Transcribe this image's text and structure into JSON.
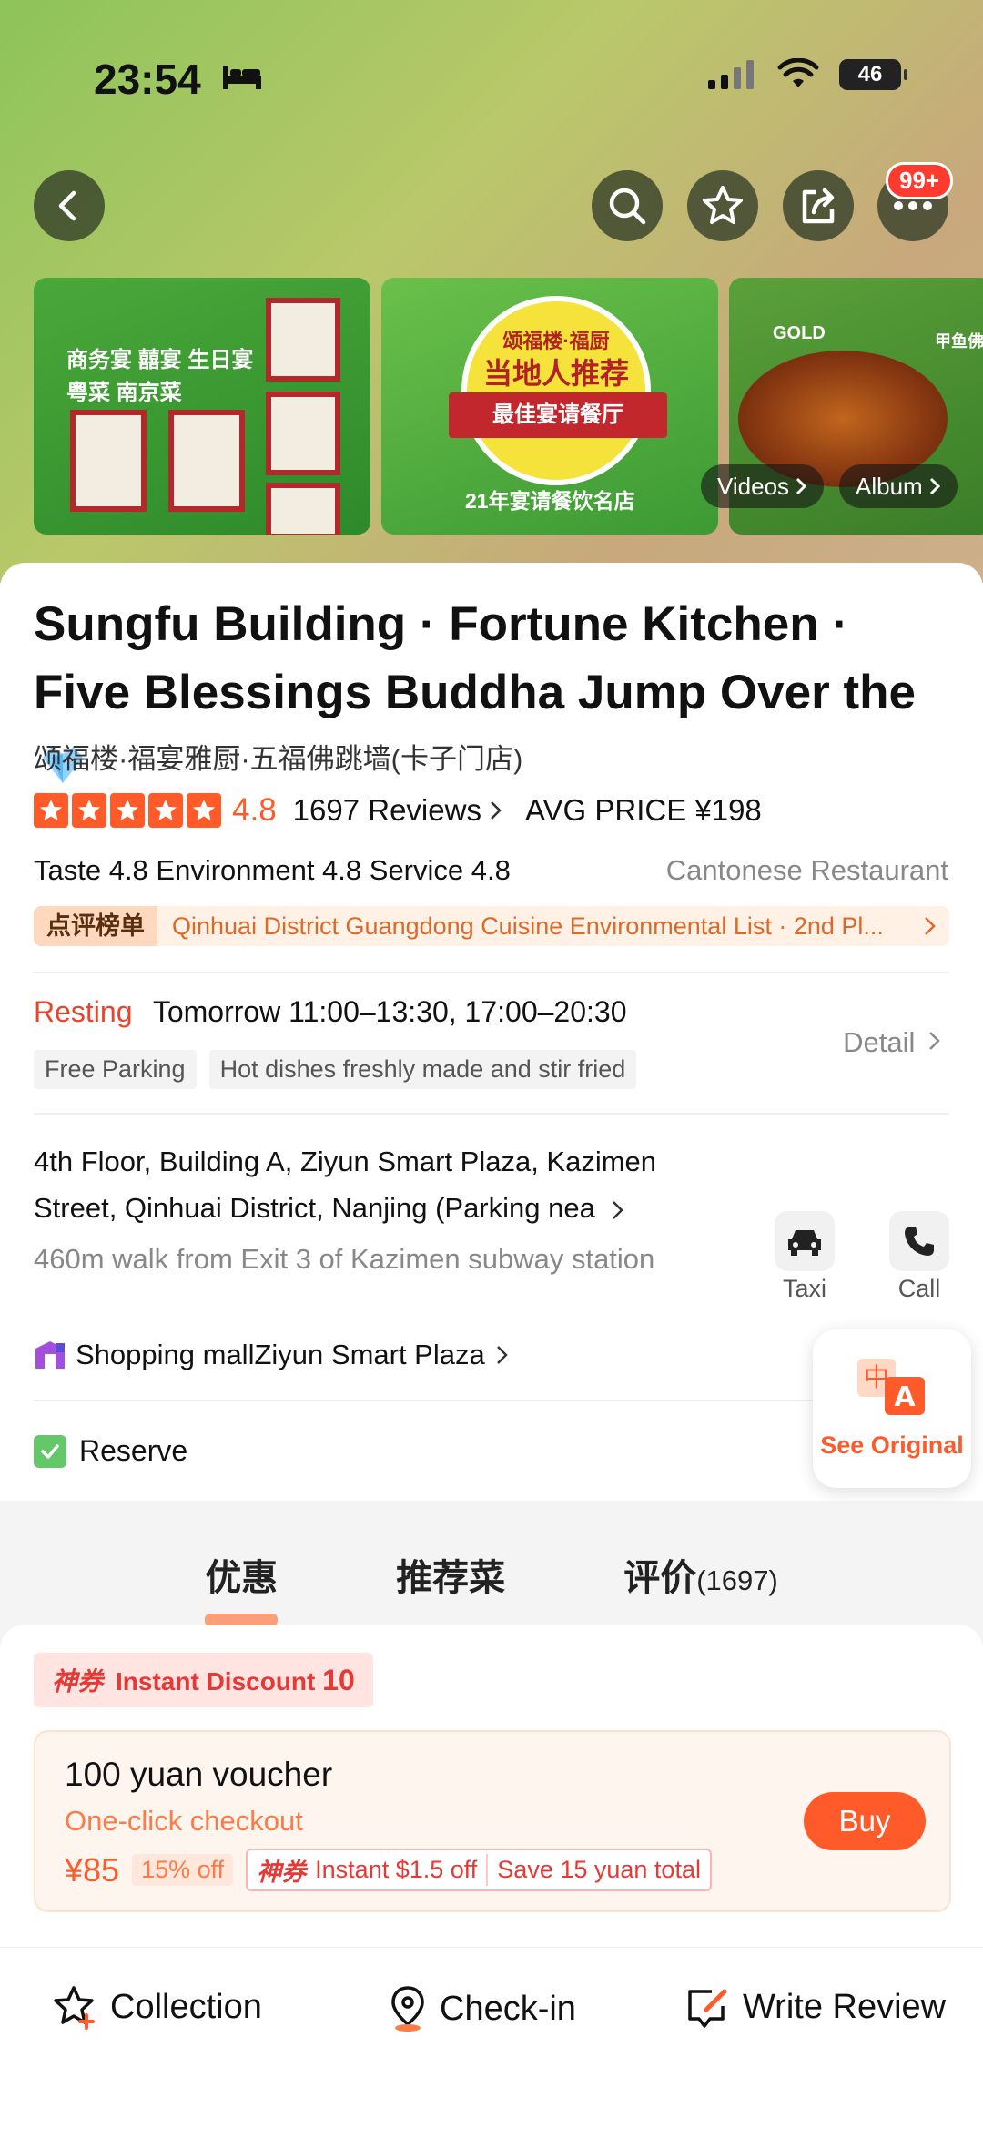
{
  "status_bar": {
    "time": "23:54",
    "battery": "46"
  },
  "header": {
    "notification_count": "99+"
  },
  "gallery": {
    "card1_lines": [
      "商务宴 囍宴 生日宴",
      "粤菜 南京菜"
    ],
    "card2_top": "颂福楼·福厨",
    "card2_main": "当地人推荐",
    "card2_band": "最佳宴请餐厅",
    "card2_bottom": "21年宴请餐饮名店",
    "card3_badge": "GOLD",
    "card3_name": "甲鱼佛",
    "videos_label": "Videos",
    "album_label": "Album"
  },
  "shop": {
    "title": "Sungfu Building · Fortune Kitchen · Five Blessings Buddha Jump Over the",
    "subtitle": "颂福楼·福宴雅厨·五福佛跳墙(卡子门店)",
    "rating": "4.8",
    "reviews": "1697 Reviews",
    "avg_price": "AVG PRICE ¥198",
    "scores": "Taste 4.8  Environment 4.8  Service 4.8",
    "category": "Cantonese Restaurant",
    "rank_tag": "点评榜单",
    "rank_text": "Qinhuai District Guangdong Cuisine Environmental List · 2nd Pl..."
  },
  "hours": {
    "status": "Resting",
    "text": "Tomorrow 11:00–13:30, 17:00–20:30",
    "tags": [
      "Free Parking",
      "Hot dishes freshly made and stir fried"
    ],
    "detail_label": "Detail"
  },
  "location": {
    "address": "4th Floor, Building A, Ziyun Smart Plaza, Kazimen Street, Qinhuai District, Nanjing (Parking nea",
    "distance": "460m walk from Exit 3 of Kazimen subway station",
    "taxi_label": "Taxi",
    "call_label": "Call",
    "mall_prefix": "Shopping mall",
    "mall_name": "Ziyun Smart Plaza"
  },
  "reserve_label": "Reserve",
  "see_original_label": "See Original",
  "tabs": [
    {
      "label": "优惠"
    },
    {
      "label": "推荐菜"
    },
    {
      "label": "评价",
      "count": "(1697)"
    }
  ],
  "deal": {
    "chip_logo": "神券",
    "chip_text": "Instant Discount",
    "chip_count": "10",
    "voucher_title": "100 yuan voucher",
    "voucher_sub": "One-click checkout",
    "price": "¥85",
    "off": "15% off",
    "promo_logo": "神券",
    "promo_instant": "Instant $1.5 off",
    "promo_save": "Save 15 yuan total",
    "buy_label": "Buy"
  },
  "bottom_bar": {
    "collection": "Collection",
    "checkin": "Check-in",
    "write_review": "Write Review"
  },
  "colors": {
    "accent": "#ff5b2a",
    "rest_red": "#e8452c",
    "hero_green": "#8dc45a"
  }
}
